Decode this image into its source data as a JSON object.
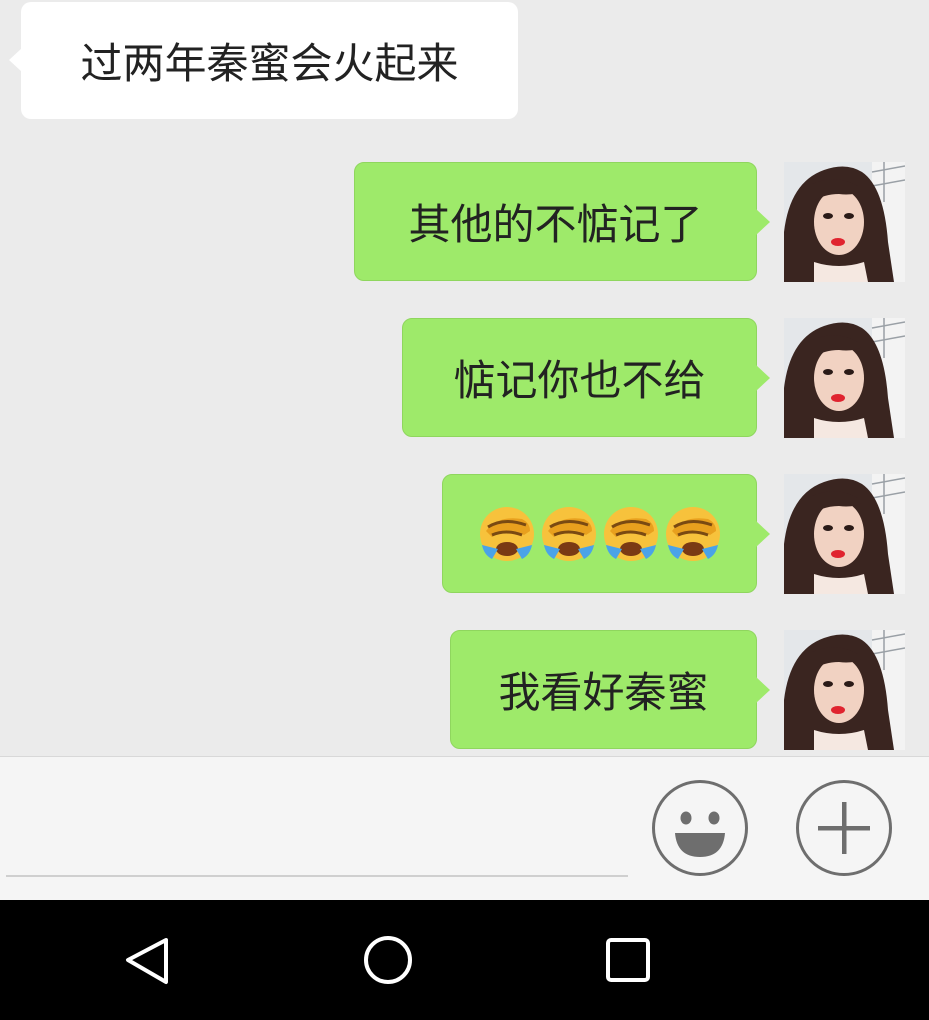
{
  "conversation": {
    "messages": [
      {
        "direction": "in",
        "text": "过两年秦蜜会火起来"
      },
      {
        "direction": "out",
        "text": "其他的不惦记了"
      },
      {
        "direction": "out",
        "text": "惦记你也不给"
      },
      {
        "direction": "out",
        "emoji": [
          "face-palm-crying-emoji",
          "face-palm-crying-emoji",
          "face-palm-crying-emoji",
          "face-palm-crying-emoji"
        ]
      },
      {
        "direction": "out",
        "text": "我看好秦蜜"
      }
    ]
  },
  "input_bar": {
    "text_value": "",
    "emoji_button_icon": "smiley-face-icon",
    "more_button_icon": "plus-icon"
  },
  "nav_bar": {
    "back_icon": "triangle-back-icon",
    "home_icon": "circle-home-icon",
    "recents_icon": "square-recents-icon"
  },
  "colors": {
    "chat_background": "#ebebeb",
    "outgoing_bubble": "#9eea6a",
    "incoming_bubble": "#ffffff",
    "nav_background": "#000000"
  }
}
